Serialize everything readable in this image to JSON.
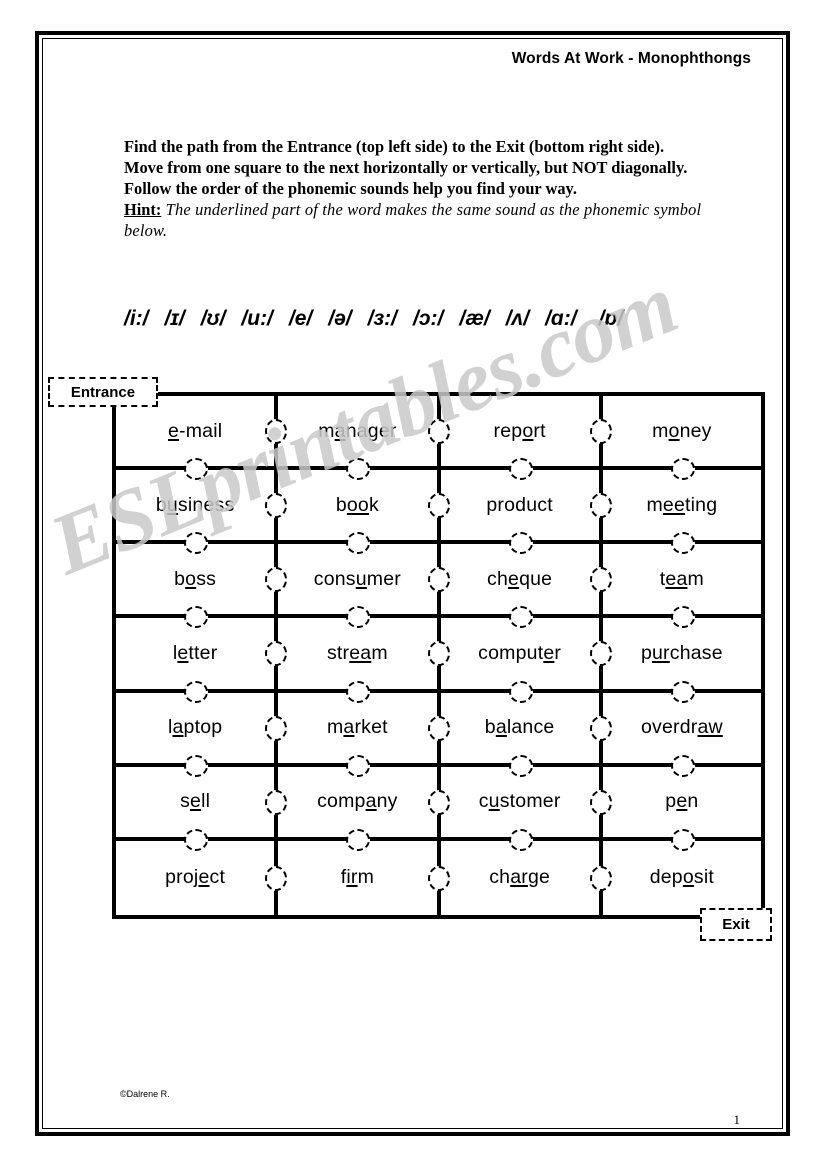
{
  "header": {
    "title": "Words At Work - Monophthongs"
  },
  "instructions": {
    "line1": "Find the path from the Entrance (top left side) to the Exit (bottom right side).",
    "line2": "Move from one square to the next horizontally or vertically, but NOT diagonally.",
    "line3": "Follow the order of the phonemic sounds help you find your way.",
    "hint_label": "Hint:",
    "hint_text": " The underlined part of the word makes the same sound as the phonemic symbol below."
  },
  "phonemes": [
    "/i:/",
    "/ɪ/",
    "/ʊ/",
    "/u:/",
    "/e/",
    "/ə/",
    "/ɜ:/",
    "/ɔ:/",
    "/æ/",
    "/ʌ/",
    "/ɑ:/",
    "/ɒ/"
  ],
  "maze": {
    "entrance_label": "Entrance",
    "exit_label": "Exit",
    "rows": [
      [
        {
          "pre": "",
          "mark": "e",
          "post": "-mail"
        },
        {
          "pre": "m",
          "mark": "a",
          "post": "nager"
        },
        {
          "pre": "rep",
          "mark": "o",
          "post": "rt"
        },
        {
          "pre": "m",
          "mark": "o",
          "post": "ney"
        }
      ],
      [
        {
          "pre": "b",
          "mark": "u",
          "post": "siness"
        },
        {
          "pre": "b",
          "mark": "oo",
          "post": "k"
        },
        {
          "pre": "product",
          "mark": "",
          "post": ""
        },
        {
          "pre": "m",
          "mark": "ee",
          "post": "ting"
        }
      ],
      [
        {
          "pre": "b",
          "mark": "o",
          "post": "ss"
        },
        {
          "pre": "cons",
          "mark": "u",
          "post": "mer"
        },
        {
          "pre": "ch",
          "mark": "e",
          "post": "que"
        },
        {
          "pre": "t",
          "mark": "ea",
          "post": "m"
        }
      ],
      [
        {
          "pre": "l",
          "mark": "e",
          "post": "tter"
        },
        {
          "pre": "str",
          "mark": "ea",
          "post": "m"
        },
        {
          "pre": "comput",
          "mark": "e",
          "post": "r"
        },
        {
          "pre": "p",
          "mark": "ur",
          "post": "chase"
        }
      ],
      [
        {
          "pre": "l",
          "mark": "a",
          "post": "ptop"
        },
        {
          "pre": "m",
          "mark": "a",
          "post": "rket"
        },
        {
          "pre": "b",
          "mark": "a",
          "post": "lance"
        },
        {
          "pre": "overdr",
          "mark": "aw",
          "post": ""
        }
      ],
      [
        {
          "pre": "s",
          "mark": "e",
          "post": "ll"
        },
        {
          "pre": "comp",
          "mark": "a",
          "post": "ny"
        },
        {
          "pre": "c",
          "mark": "u",
          "post": "stomer"
        },
        {
          "pre": "p",
          "mark": "e",
          "post": "n"
        }
      ],
      [
        {
          "pre": "proj",
          "mark": "e",
          "post": "ct"
        },
        {
          "pre": "f",
          "mark": "ir",
          "post": "m"
        },
        {
          "pre": "ch",
          "mark": "ar",
          "post": "ge"
        },
        {
          "pre": "dep",
          "mark": "o",
          "post": "sit"
        }
      ]
    ]
  },
  "watermark": {
    "text": "ESLprintables.com"
  },
  "footer": {
    "copyright": "©Dalrene R.",
    "page_number": "1"
  }
}
